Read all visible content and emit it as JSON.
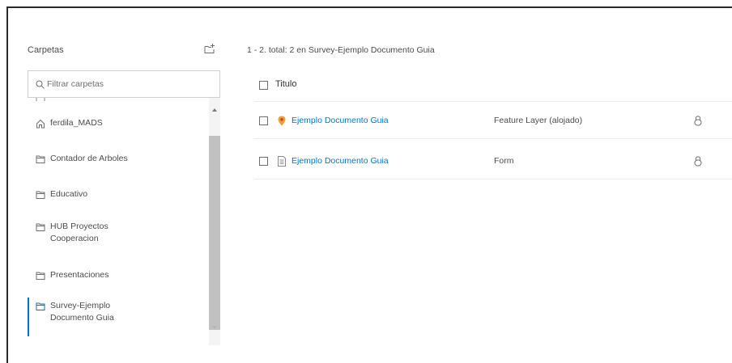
{
  "sidebar": {
    "title": "Carpetas",
    "new_folder_icon": "new-folder-icon",
    "search_placeholder": "Filtrar carpetas",
    "items": [
      {
        "label": "ferdila_MADS",
        "icon": "home-icon",
        "active": false
      },
      {
        "label": "Contador de Arboles",
        "icon": "folder-icon",
        "active": false
      },
      {
        "label": "Educativo",
        "icon": "folder-icon",
        "active": false
      },
      {
        "label": "HUB Proyectos",
        "label2": "Cooperacion",
        "icon": "folder-icon",
        "active": false
      },
      {
        "label": "Presentaciones",
        "icon": "folder-icon",
        "active": false
      },
      {
        "label": "Survey-Ejemplo",
        "label2": "Documento Guia",
        "icon": "folder-open-icon",
        "active": true
      }
    ]
  },
  "content": {
    "summary": "1 - 2. total: 2 en Survey-Ejemplo Documento Guia",
    "header": {
      "title": "Titulo"
    },
    "rows": [
      {
        "title": "Ejemplo Documento Guia",
        "type": "Feature Layer (alojado)",
        "icon": "feature-layer-icon",
        "sharing_icon": "lock-icon"
      },
      {
        "title": "Ejemplo Documento Guia",
        "type": "Form",
        "icon": "form-document-icon",
        "sharing_icon": "lock-icon"
      }
    ]
  },
  "colors": {
    "accent": "#0079c1",
    "feature_layer_icon": "#e8a23a"
  }
}
